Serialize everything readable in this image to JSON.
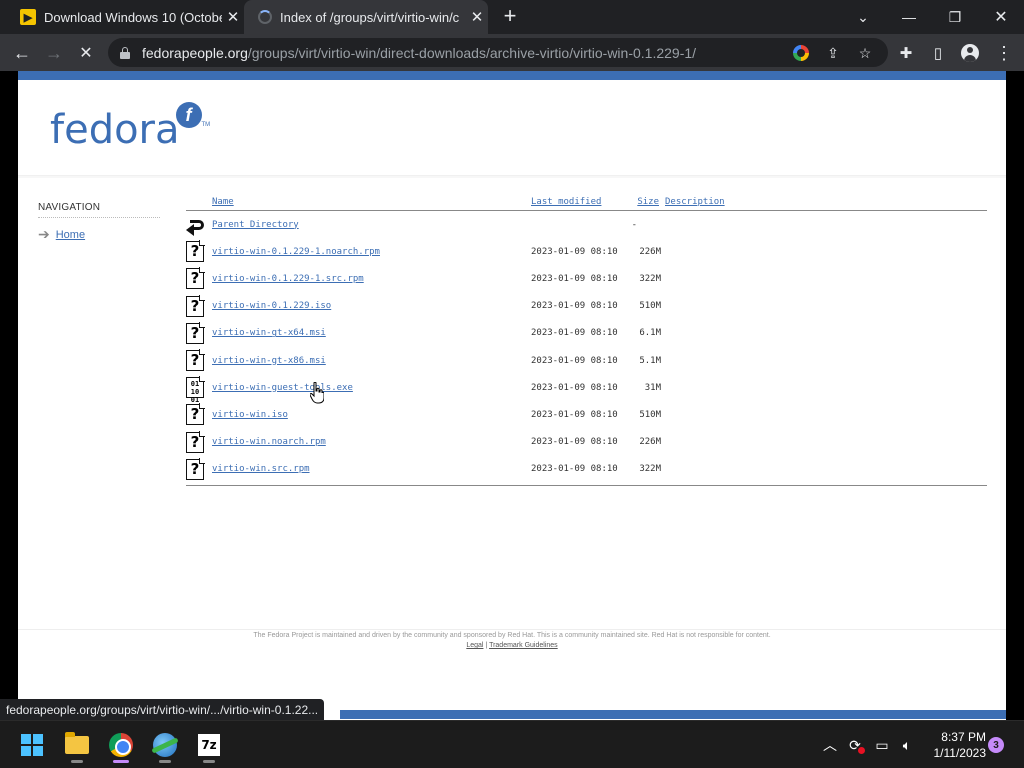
{
  "browser": {
    "tabs": [
      {
        "title": "Download Windows 10 (October",
        "close": "✕",
        "favicon": "yellow-brand-icon"
      },
      {
        "title": "Index of /groups/virt/virtio-win/c",
        "close": "✕",
        "favicon": "loading-spinner"
      }
    ],
    "new_tab": "+",
    "url_host": "fedorapeople.org",
    "url_path": "/groups/virt/virtio-win/direct-downloads/archive-virtio/virtio-win-0.1.229-1/",
    "status_url": "fedorapeople.org/groups/virt/virtio-win/.../virtio-win-0.1.22..."
  },
  "page": {
    "logo_text": "fedora",
    "logo_tm": "TM",
    "nav": {
      "title": "NAVIGATION",
      "items": [
        {
          "label": "Home"
        }
      ]
    },
    "listing": {
      "headers": {
        "name": "Name",
        "modified": "Last modified",
        "size": "Size",
        "description": "Description"
      },
      "parent": {
        "name": "Parent Directory",
        "size": "-"
      },
      "rows": [
        {
          "name": "virtio-win-0.1.229-1.noarch.rpm",
          "modified": "2023-01-09 08:10",
          "size": "226M",
          "icon": "unknown-file-icon"
        },
        {
          "name": "virtio-win-0.1.229-1.src.rpm",
          "modified": "2023-01-09 08:10",
          "size": "322M",
          "icon": "unknown-file-icon"
        },
        {
          "name": "virtio-win-0.1.229.iso",
          "modified": "2023-01-09 08:10",
          "size": "510M",
          "icon": "unknown-file-icon"
        },
        {
          "name": "virtio-win-gt-x64.msi",
          "modified": "2023-01-09 08:10",
          "size": "6.1M",
          "icon": "unknown-file-icon"
        },
        {
          "name": "virtio-win-gt-x86.msi",
          "modified": "2023-01-09 08:10",
          "size": "5.1M",
          "icon": "unknown-file-icon"
        },
        {
          "name": "virtio-win-guest-tools.exe",
          "modified": "2023-01-09 08:10",
          "size": "31M",
          "icon": "binary-file-icon"
        },
        {
          "name": "virtio-win.iso",
          "modified": "2023-01-09 08:10",
          "size": "510M",
          "icon": "unknown-file-icon"
        },
        {
          "name": "virtio-win.noarch.rpm",
          "modified": "2023-01-09 08:10",
          "size": "226M",
          "icon": "unknown-file-icon"
        },
        {
          "name": "virtio-win.src.rpm",
          "modified": "2023-01-09 08:10",
          "size": "322M",
          "icon": "unknown-file-icon"
        }
      ]
    },
    "footer": {
      "text": "The Fedora Project is maintained and driven by the community and sponsored by Red Hat. This is a community maintained site. Red Hat is not responsible for content.",
      "links": [
        "Legal",
        "Trademark Guidelines"
      ],
      "separator": "|"
    }
  },
  "taskbar": {
    "apps": [
      "windows-start-icon",
      "file-explorer-icon",
      "chrome-icon",
      "network-globe-icon",
      "7zip-icon"
    ],
    "time": "8:37 PM",
    "date": "1/11/2023",
    "notifications": "3"
  },
  "colors": {
    "fedora_blue": "#3c6eb4",
    "chrome_dark": "#202124",
    "chrome_toolbar": "#35363a"
  }
}
